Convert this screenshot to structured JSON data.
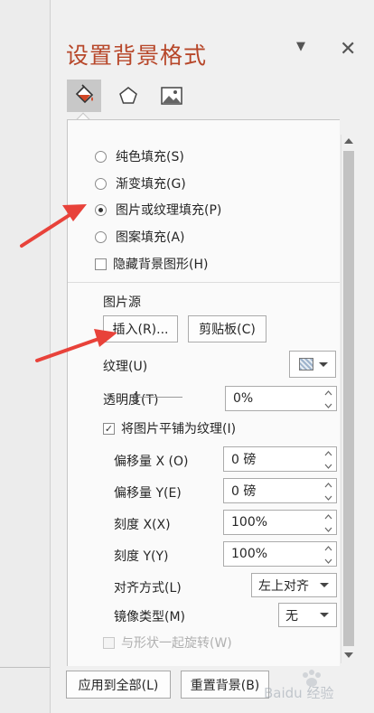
{
  "pane": {
    "title": "设置背景格式",
    "menu_glyph": "▼",
    "close_glyph": "✕",
    "category_tabs": [
      {
        "icon": "paint-bucket-icon",
        "active": true
      },
      {
        "icon": "pentagon-icon",
        "active": false
      },
      {
        "icon": "picture-icon",
        "active": false
      }
    ]
  },
  "fill": {
    "options": [
      {
        "label": "纯色填充(S)",
        "selected": false
      },
      {
        "label": "渐变填充(G)",
        "selected": false
      },
      {
        "label": "图片或纹理填充(P)",
        "selected": true
      },
      {
        "label": "图案填充(A)",
        "selected": false
      }
    ],
    "hide_background_label": "隐藏背景图形(H)",
    "picture_source_label": "图片源",
    "insert_button": "插入(R)...",
    "clipboard_button": "剪贴板(C)",
    "texture_label": "纹理(U)",
    "transparency_label": "透明度(T)",
    "transparency_value": "0%",
    "tile_label": "将图片平铺为纹理(I)",
    "tile_checked": true,
    "offset_x_label": "偏移量 X (O)",
    "offset_x_value": "0 磅",
    "offset_y_label": "偏移量 Y(E)",
    "offset_y_value": "0 磅",
    "scale_x_label": "刻度 X(X)",
    "scale_x_value": "100%",
    "scale_y_label": "刻度 Y(Y)",
    "scale_y_value": "100%",
    "alignment_label": "对齐方式(L)",
    "alignment_value": "左上对齐",
    "mirror_label": "镜像类型(M)",
    "mirror_value": "无",
    "rotate_with_shape_label": "与形状一起旋转(W)",
    "rotate_with_shape_enabled": false
  },
  "footer": {
    "apply_all_button": "应用到全部(L)",
    "reset_button": "重置背景(B)"
  },
  "watermark": {
    "text": "Baidu 经验"
  },
  "colors": {
    "accent": "#b7472a",
    "annotation_arrow": "#e8423a",
    "panel_bg": "#f0f0f0",
    "content_bg": "#fafafa"
  }
}
